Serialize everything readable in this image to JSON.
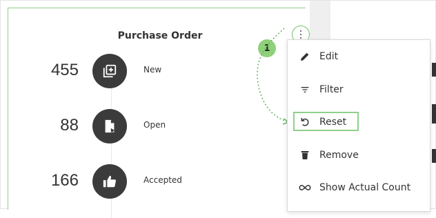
{
  "widget": {
    "title": "Purchase Order",
    "rows": [
      {
        "count": "455",
        "label": "New",
        "icon": "new-doc-plus-icon"
      },
      {
        "count": "88",
        "label": "Open",
        "icon": "open-doc-cursor-icon"
      },
      {
        "count": "166",
        "label": "Accepted",
        "icon": "thumbs-up-icon"
      }
    ]
  },
  "callout": {
    "step": "1"
  },
  "menu": {
    "items": [
      {
        "label": "Edit",
        "icon": "pencil-icon"
      },
      {
        "label": "Filter",
        "icon": "filter-icon"
      },
      {
        "label": "Reset",
        "icon": "reset-icon"
      },
      {
        "label": "Remove",
        "icon": "trash-icon"
      },
      {
        "label": "Show Actual Count",
        "icon": "infinity-icon"
      }
    ]
  },
  "colors": {
    "accent": "#8fcf8b",
    "icon_circle": "#3b3b3b"
  }
}
